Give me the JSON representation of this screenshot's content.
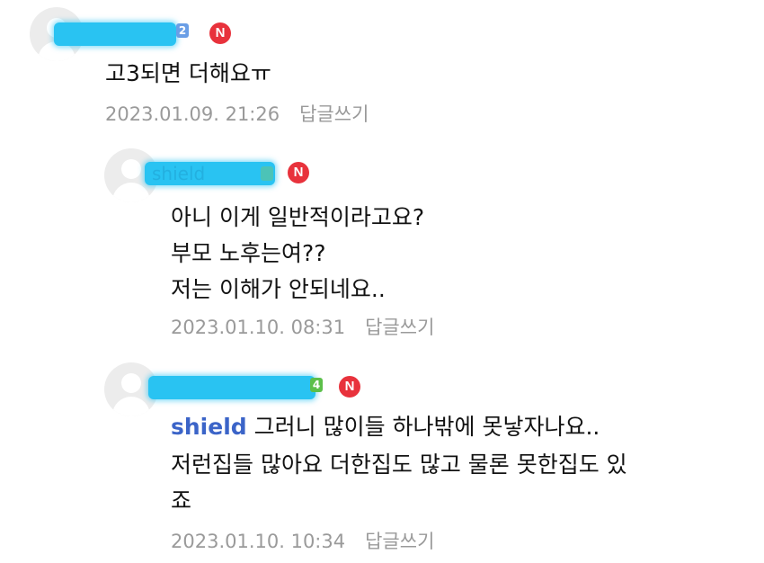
{
  "comments": [
    {
      "nickname": "",
      "level_badge": "2",
      "level_color": "#6a9ee6",
      "new_badge": "N",
      "lines": [
        "고3되면 더해요ㅠ"
      ],
      "timestamp": "2023.01.09. 21:26",
      "reply_label": "답글쓰기"
    },
    {
      "nickname": "shield",
      "level_badge": "",
      "level_color": "#8fc34a",
      "new_badge": "N",
      "lines": [
        "아니 이게 일반적이라고요?",
        "부모 노후는여??",
        "저는 이해가 안되네요.."
      ],
      "timestamp": "2023.01.10. 08:31",
      "reply_label": "답글쓰기"
    },
    {
      "nickname": "",
      "level_badge": "4",
      "level_color": "#5cbf4a",
      "new_badge": "N",
      "mention": "shield",
      "lines": [
        " 그러니 많이들 하나밖에 못낳자나요..",
        "저런집들 많아요 더한집도 많고 물론 못한집도 있",
        "죠"
      ],
      "timestamp": "2023.01.10. 10:34",
      "reply_label": "답글쓰기"
    }
  ]
}
